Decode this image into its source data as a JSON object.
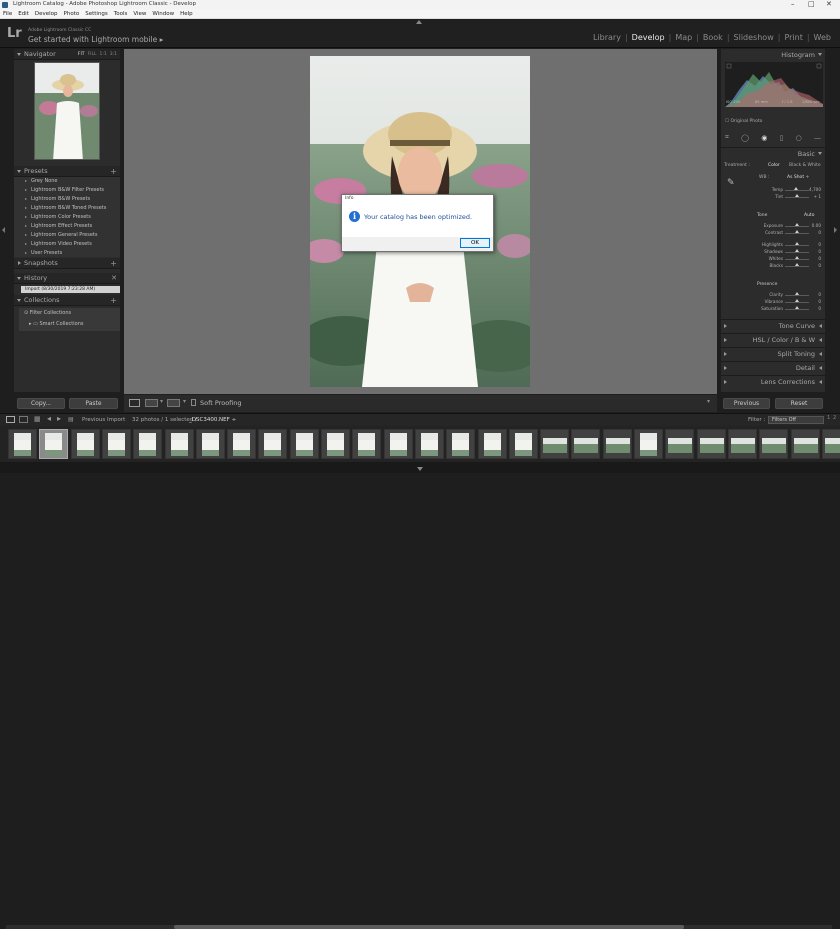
{
  "window": {
    "title": "Lightroom Catalog - Adobe Photoshop Lightroom Classic - Develop",
    "controls": [
      "–",
      "□",
      "✕"
    ]
  },
  "menu": [
    "File",
    "Edit",
    "Develop",
    "Photo",
    "Settings",
    "Tools",
    "View",
    "Window",
    "Help"
  ],
  "identity": {
    "logo": "Lr",
    "catalog": "Adobe Lightroom Classic CC",
    "get_started": "Get started with Lightroom mobile ▸"
  },
  "modules": [
    {
      "label": "Library",
      "active": false
    },
    {
      "label": "Develop",
      "active": true
    },
    {
      "label": "Map",
      "active": false
    },
    {
      "label": "Book",
      "active": false
    },
    {
      "label": "Slideshow",
      "active": false
    },
    {
      "label": "Print",
      "active": false
    },
    {
      "label": "Web",
      "active": false
    }
  ],
  "left": {
    "navigator": {
      "label": "Navigator",
      "options": [
        "FIT",
        "FILL",
        "1:1",
        "3:1"
      ]
    },
    "presets": {
      "label": "Presets",
      "items": [
        "Grey None",
        "Lightroom B&W Filter Presets",
        "Lightroom B&W Presets",
        "Lightroom B&W Toned Presets",
        "Lightroom Color Presets",
        "Lightroom Effect Presets",
        "Lightroom General Presets",
        "Lightroom Video Presets",
        "User Presets"
      ]
    },
    "snapshots": {
      "label": "Snapshots"
    },
    "history": {
      "label": "History",
      "item": "Import (8/30/2019 7:23:28 AM)"
    },
    "collections": {
      "label": "Collections",
      "items": [
        "Filter Collections",
        "Smart Collections"
      ]
    },
    "copy_label": "Copy...",
    "paste_label": "Paste"
  },
  "toolbar": {
    "soft_proofing": "Soft Proofing"
  },
  "dialog": {
    "title": "Info",
    "message": "Your catalog has been optimized.",
    "ok": "OK",
    "icon": "i"
  },
  "right": {
    "histogram": {
      "label": "Histogram",
      "info": [
        "ISO 200",
        "85 mm",
        "f / 1.8",
        "1/800 sec"
      ]
    },
    "original_photo": "Original Photo",
    "basic": {
      "label": "Basic",
      "treatment_label": "Treatment :",
      "treatment_options": [
        "Color",
        "Black & White"
      ],
      "wb_label": "WB :",
      "wb_value": "As Shot ÷",
      "tone_label": "Tone",
      "tone_auto": "Auto",
      "presence_label": "Presence",
      "sliders": [
        {
          "label": "Temp",
          "value": "4,700",
          "pos": 0.45
        },
        {
          "label": "Tint",
          "value": "+ 1",
          "pos": 0.5
        },
        {
          "label": "Exposure",
          "value": "0.00",
          "pos": 0.5
        },
        {
          "label": "Contrast",
          "value": "0",
          "pos": 0.5
        },
        {
          "label": "Highlights",
          "value": "0",
          "pos": 0.5
        },
        {
          "label": "Shadows",
          "value": "0",
          "pos": 0.5
        },
        {
          "label": "Whites",
          "value": "0",
          "pos": 0.5
        },
        {
          "label": "Blacks",
          "value": "0",
          "pos": 0.5
        },
        {
          "label": "Clarity",
          "value": "0",
          "pos": 0.5
        },
        {
          "label": "Vibrance",
          "value": "0",
          "pos": 0.5
        },
        {
          "label": "Saturation",
          "value": "0",
          "pos": 0.5
        }
      ]
    },
    "sections": [
      "Tone Curve",
      "HSL / Color / B & W",
      "Split Toning",
      "Detail",
      "Lens Corrections"
    ],
    "previous_label": "Previous",
    "reset_label": "Reset"
  },
  "filmstrip": {
    "source": "Previous Import",
    "count": "32 photos / 1 selected /",
    "file": "_DSC3400.NEF ÷",
    "filter_label": "Filter :",
    "filter_value": "Filters Off",
    "page_numbers": [
      "1",
      "2"
    ]
  }
}
